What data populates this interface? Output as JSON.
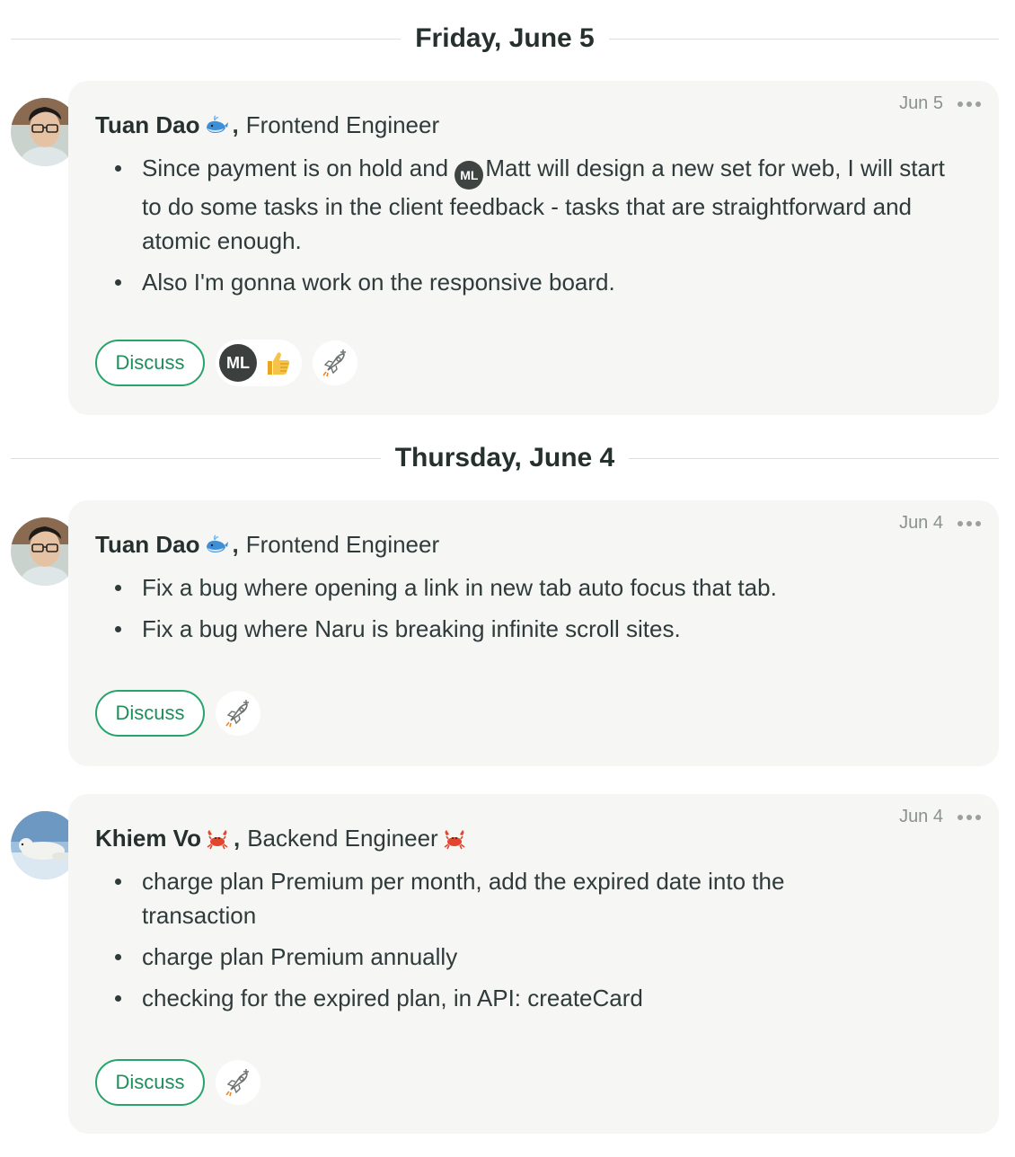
{
  "days": [
    {
      "label": "Friday, June 5",
      "posts": [
        {
          "author": "Tuan Dao",
          "author_emoji": "whale-emoji",
          "separator": ",",
          "role": "Frontend Engineer",
          "date": "Jun 5",
          "items": [
            {
              "before_mention": "Since payment is on hold and ",
              "mention_initials": "ML",
              "after_mention": "Matt will design a new set for web, I will start to do some tasks in the client feedback - tasks that are straightforward and atomic enough."
            },
            {
              "text": "Also I'm gonna work on the responsive board."
            }
          ],
          "discuss_label": "Discuss",
          "reaction": {
            "initials": "ML",
            "emoji": "thumbs-up-emoji"
          }
        }
      ]
    },
    {
      "label": "Thursday, June 4",
      "posts": [
        {
          "author": "Tuan Dao",
          "author_emoji": "whale-emoji",
          "separator": ",",
          "role": "Frontend Engineer",
          "date": "Jun 4",
          "items": [
            {
              "text": "Fix a bug where opening a link in new tab auto focus that tab."
            },
            {
              "text": "Fix a bug where Naru is breaking infinite scroll sites."
            }
          ],
          "discuss_label": "Discuss"
        },
        {
          "author": "Khiem Vo",
          "author_emoji": "crab-emoji",
          "separator": ",",
          "role": "Backend Engineer",
          "role_emoji": "crab-emoji",
          "date": "Jun 4",
          "items": [
            {
              "text": "charge plan Premium per month, add the expired date into the transaction"
            },
            {
              "text": "charge plan Premium annually"
            },
            {
              "text": "checking for the expired plan, in API: createCard"
            }
          ],
          "discuss_label": "Discuss"
        }
      ]
    }
  ],
  "colors": {
    "accent": "#27a36b",
    "card_bg": "#f6f6f5",
    "text": "#2f3b3a"
  }
}
